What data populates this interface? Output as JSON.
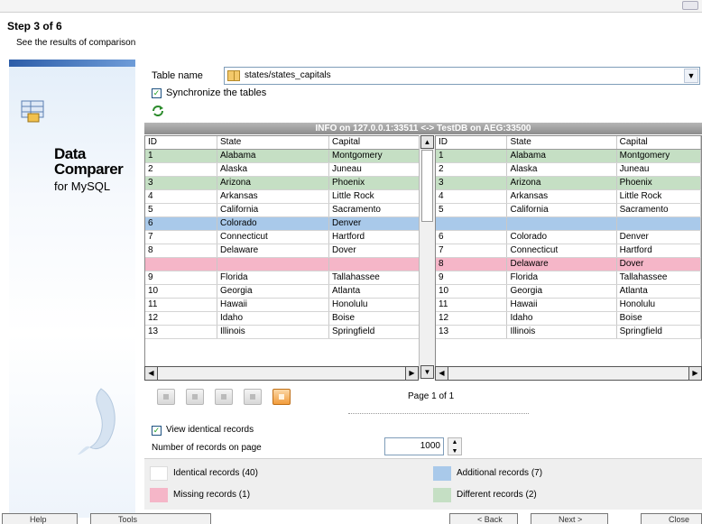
{
  "header": {
    "step_title": "Step 3 of 6",
    "step_subtitle": "See the results of comparison"
  },
  "sidebar": {
    "product_line1": "Data",
    "product_line2": "Comparer",
    "product_sub": "for MySQL"
  },
  "table_name": {
    "label": "Table name",
    "value": "states/states_capitals"
  },
  "sync": {
    "label": "Synchronize the tables",
    "checked": true
  },
  "comparison": {
    "title": "INFO on 127.0.0.1:33511 <-> TestDB on AEG:33500",
    "columns": [
      "ID",
      "State",
      "Capital"
    ],
    "left_rows": [
      {
        "id": "1",
        "state": "Alabama",
        "capital": "Montgomery",
        "status": "different"
      },
      {
        "id": "2",
        "state": "Alaska",
        "capital": "Juneau",
        "status": "identical"
      },
      {
        "id": "3",
        "state": "Arizona",
        "capital": "Phoenix",
        "status": "different"
      },
      {
        "id": "4",
        "state": "Arkansas",
        "capital": "Little Rock",
        "status": "identical"
      },
      {
        "id": "5",
        "state": "California",
        "capital": "Sacramento",
        "status": "identical"
      },
      {
        "id": "6",
        "state": "Colorado",
        "capital": "Denver",
        "status": "additional"
      },
      {
        "id": "7",
        "state": "Connecticut",
        "capital": "Hartford",
        "status": "identical"
      },
      {
        "id": "8",
        "state": "Delaware",
        "capital": "Dover",
        "status": "identical"
      },
      {
        "id": "",
        "state": "",
        "capital": "",
        "status": "missing"
      },
      {
        "id": "9",
        "state": "Florida",
        "capital": "Tallahassee",
        "status": "identical"
      },
      {
        "id": "10",
        "state": "Georgia",
        "capital": "Atlanta",
        "status": "identical"
      },
      {
        "id": "11",
        "state": "Hawaii",
        "capital": "Honolulu",
        "status": "identical"
      },
      {
        "id": "12",
        "state": "Idaho",
        "capital": "Boise",
        "status": "identical"
      },
      {
        "id": "13",
        "state": "Illinois",
        "capital": "Springfield",
        "status": "identical"
      }
    ],
    "right_rows": [
      {
        "id": "1",
        "state": "Alabama",
        "capital": "Montgomery",
        "status": "different"
      },
      {
        "id": "2",
        "state": "Alaska",
        "capital": "Juneau",
        "status": "identical"
      },
      {
        "id": "3",
        "state": "Arizona",
        "capital": "Phoenix",
        "status": "different"
      },
      {
        "id": "4",
        "state": "Arkansas",
        "capital": "Little Rock",
        "status": "identical"
      },
      {
        "id": "5",
        "state": "California",
        "capital": "Sacramento",
        "status": "identical"
      },
      {
        "id": "",
        "state": "",
        "capital": "",
        "status": "additional"
      },
      {
        "id": "6",
        "state": "Colorado",
        "capital": "Denver",
        "status": "identical"
      },
      {
        "id": "7",
        "state": "Connecticut",
        "capital": "Hartford",
        "status": "identical"
      },
      {
        "id": "8",
        "state": "Delaware",
        "capital": "Dover",
        "status": "missing"
      },
      {
        "id": "9",
        "state": "Florida",
        "capital": "Tallahassee",
        "status": "identical"
      },
      {
        "id": "10",
        "state": "Georgia",
        "capital": "Atlanta",
        "status": "identical"
      },
      {
        "id": "11",
        "state": "Hawaii",
        "capital": "Honolulu",
        "status": "identical"
      },
      {
        "id": "12",
        "state": "Idaho",
        "capital": "Boise",
        "status": "identical"
      },
      {
        "id": "13",
        "state": "Illinois",
        "capital": "Springfield",
        "status": "identical"
      }
    ]
  },
  "pagination": {
    "page_info": "Page 1 of 1"
  },
  "view_identical": {
    "label": "View identical records",
    "checked": true
  },
  "records_per_page": {
    "label": "Number of records on page",
    "value": "1000"
  },
  "legend": {
    "identical": "Identical records (40)",
    "missing": "Missing records (1)",
    "additional": "Additional records (7)",
    "different": "Different records (2)"
  },
  "colors": {
    "identical": "#ffffff",
    "missing": "#f5b6c8",
    "additional": "#a9c9ea",
    "different": "#c5dfc4"
  },
  "footer": {
    "help": "Help",
    "tools": "Tools",
    "back": "< Back",
    "next": "Next >",
    "close": "Close"
  }
}
